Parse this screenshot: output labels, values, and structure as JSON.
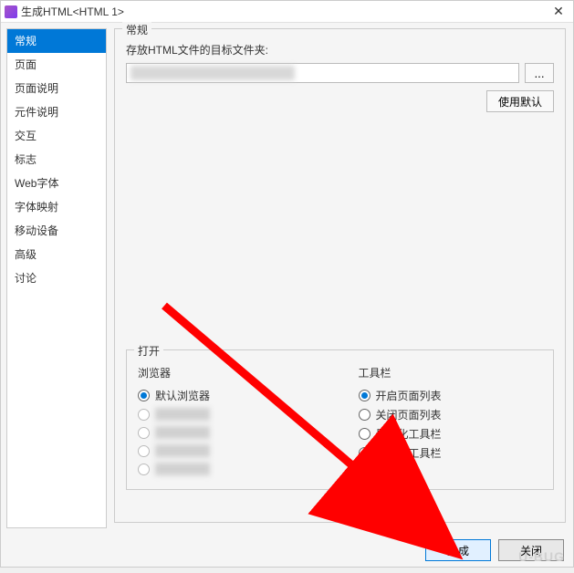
{
  "titlebar": {
    "title": "生成HTML<HTML 1>",
    "close_icon": "✕"
  },
  "sidebar": {
    "items": [
      {
        "label": "常规",
        "selected": true
      },
      {
        "label": "页面",
        "selected": false
      },
      {
        "label": "页面说明",
        "selected": false
      },
      {
        "label": "元件说明",
        "selected": false
      },
      {
        "label": "交互",
        "selected": false
      },
      {
        "label": "标志",
        "selected": false
      },
      {
        "label": "Web字体",
        "selected": false
      },
      {
        "label": "字体映射",
        "selected": false
      },
      {
        "label": "移动设备",
        "selected": false
      },
      {
        "label": "高级",
        "selected": false
      },
      {
        "label": "讨论",
        "selected": false
      }
    ]
  },
  "main": {
    "general": {
      "legend": "常规",
      "target_folder_label": "存放HTML文件的目标文件夹:",
      "path_value": "",
      "browse_label": "...",
      "use_default_label": "使用默认"
    },
    "open": {
      "legend": "打开",
      "browser": {
        "label": "浏览器",
        "options": [
          {
            "label": "默认浏览器",
            "checked": true,
            "blurred": false
          },
          {
            "label": "",
            "checked": false,
            "blurred": true
          },
          {
            "label": "",
            "checked": false,
            "blurred": true
          },
          {
            "label": "",
            "checked": false,
            "blurred": true
          },
          {
            "label": "",
            "checked": false,
            "blurred": true
          }
        ]
      },
      "toolbar": {
        "label": "工具栏",
        "options": [
          {
            "label": "开启页面列表",
            "checked": true
          },
          {
            "label": "关闭页面列表",
            "checked": false
          },
          {
            "label": "最小化工具栏",
            "checked": false
          },
          {
            "label": "不加载工具栏",
            "checked": false
          }
        ]
      }
    }
  },
  "footer": {
    "generate_label": "生成",
    "close_label": "关闭"
  }
}
